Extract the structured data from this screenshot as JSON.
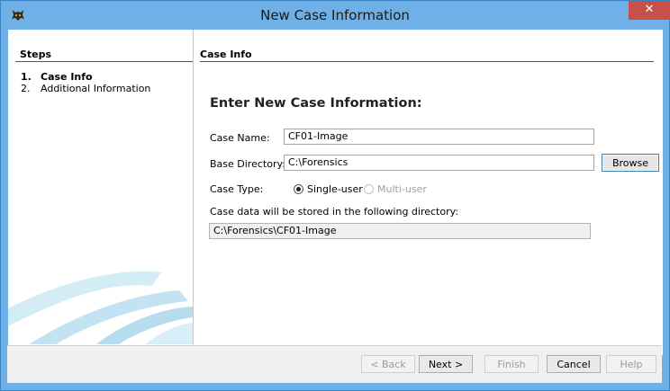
{
  "window": {
    "title": "New Case Information",
    "close_label": "✕",
    "app_icon": "autopsy-dog-icon"
  },
  "steps": {
    "title": "Steps",
    "items": [
      {
        "number": "1.",
        "label": "Case Info",
        "current": true
      },
      {
        "number": "2.",
        "label": "Additional Information",
        "current": false
      }
    ]
  },
  "main": {
    "section_title": "Case Info",
    "heading": "Enter New Case Information:",
    "case_name_label": "Case Name:",
    "case_name_value": "CF01-Image",
    "base_dir_label": "Base Directory:",
    "base_dir_value": "C:\\Forensics",
    "browse_label": "Browse",
    "case_type_label": "Case Type:",
    "single_user_label": "Single-user",
    "multi_user_label": "Multi-user",
    "case_type_selected": "Single-user",
    "storage_note": "Case data will be stored in the following directory:",
    "storage_path": "C:\\Forensics\\CF01-Image"
  },
  "footer": {
    "back_label": "< Back",
    "next_label": "Next >",
    "finish_label": "Finish",
    "cancel_label": "Cancel",
    "help_label": "Help"
  },
  "colors": {
    "title_bar": "#6fb0e6",
    "close_button": "#c7504a"
  }
}
